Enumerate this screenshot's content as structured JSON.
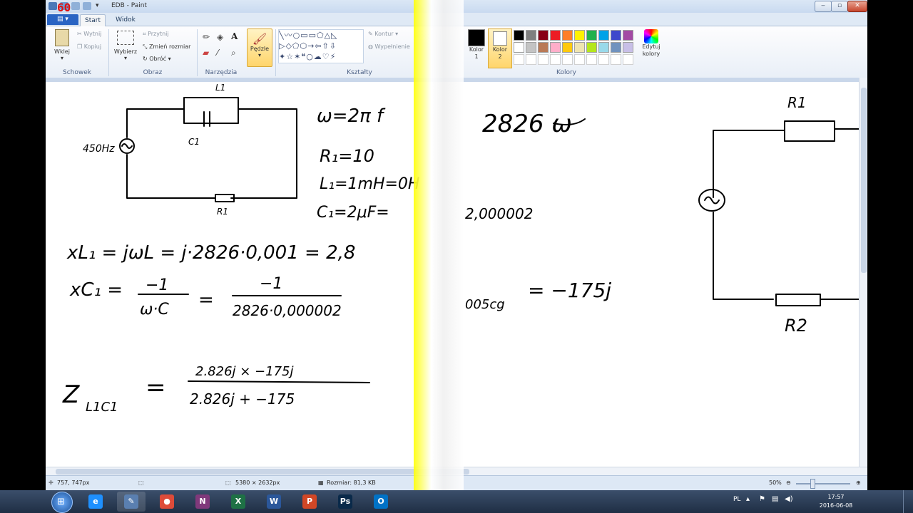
{
  "window": {
    "title": "EDB - Paint"
  },
  "overlay": {
    "fps": "60"
  },
  "tabs": [
    {
      "label": "Start"
    },
    {
      "label": "Widok"
    }
  ],
  "ribbon": {
    "clipboard": {
      "label": "Schowek",
      "paste": "Wklej",
      "cut": "Wytnij",
      "copy": "Kopiuj"
    },
    "image": {
      "label": "Obraz",
      "select": "Wybierz",
      "crop": "Przytnij",
      "resize": "Zmień rozmiar",
      "rotate": "Obróć"
    },
    "tools": {
      "label": "Narzędzia"
    },
    "brushes": {
      "label": "Pędzle"
    },
    "shapes": {
      "label": "Kształty",
      "outline": "Kontur",
      "fill": "Wypełnienie"
    },
    "colors": {
      "label": "Kolory",
      "color1": "Kolor\n1",
      "color2": "Kolor\n2",
      "edit": "Edytuj\nkolory",
      "palette_row1": [
        "#000000",
        "#7f7f7f",
        "#880015",
        "#ed1c24",
        "#ff7f27",
        "#fff200",
        "#22b14c",
        "#00a2e8",
        "#3f48cc",
        "#a349a4"
      ],
      "palette_row2": [
        "#ffffff",
        "#c3c3c3",
        "#b97a57",
        "#ffaec9",
        "#ffc90e",
        "#efe4b0",
        "#b5e61d",
        "#99d9ea",
        "#7092be",
        "#c8bfe7"
      ]
    }
  },
  "status": {
    "cursor": "757, 747px",
    "dimensions": "5380 × 2632px",
    "size": "Rozmiar: 81,3 KB",
    "zoom": "50%"
  },
  "taskbar": {
    "lang": "PL",
    "time": "17:57",
    "date": "2016-06-08",
    "apps": [
      {
        "name": "ie",
        "glyph": "e",
        "color": "#1e90ff"
      },
      {
        "name": "paint",
        "glyph": "✎",
        "color": "#5a7fb0"
      },
      {
        "name": "chrome",
        "glyph": "●",
        "color": "#dd4b39"
      },
      {
        "name": "onenote",
        "glyph": "N",
        "color": "#80397b"
      },
      {
        "name": "excel",
        "glyph": "X",
        "color": "#1e7145"
      },
      {
        "name": "word",
        "glyph": "W",
        "color": "#2b579a"
      },
      {
        "name": "powerpoint",
        "glyph": "P",
        "color": "#d24726"
      },
      {
        "name": "photoshop",
        "glyph": "Ps",
        "color": "#0a2a4a"
      },
      {
        "name": "outlook",
        "glyph": "O",
        "color": "#0072c6"
      }
    ]
  }
}
